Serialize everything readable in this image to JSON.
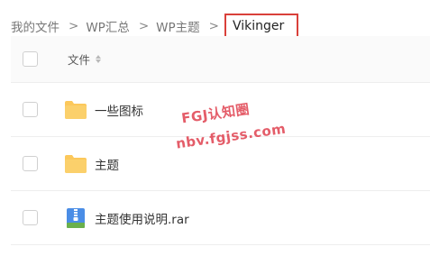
{
  "breadcrumb": {
    "items": [
      "我的文件",
      "WP汇总",
      "WP主题"
    ],
    "separator": ">",
    "current": "Vikinger"
  },
  "table": {
    "column_name": "文件",
    "rows": [
      {
        "name": "一些图标",
        "icon": "folder-icon"
      },
      {
        "name": "主题",
        "icon": "folder-icon"
      },
      {
        "name": "主题使用说明.rar",
        "icon": "archive-file-icon"
      }
    ]
  },
  "watermark": {
    "line1": "FGJ认知圈",
    "line2": "nbv.fgjss.com"
  },
  "colors": {
    "highlight_border": "#d9403a",
    "folder": "#fcc85b",
    "archive": "#4a8de6",
    "watermark": "#e0414f"
  }
}
